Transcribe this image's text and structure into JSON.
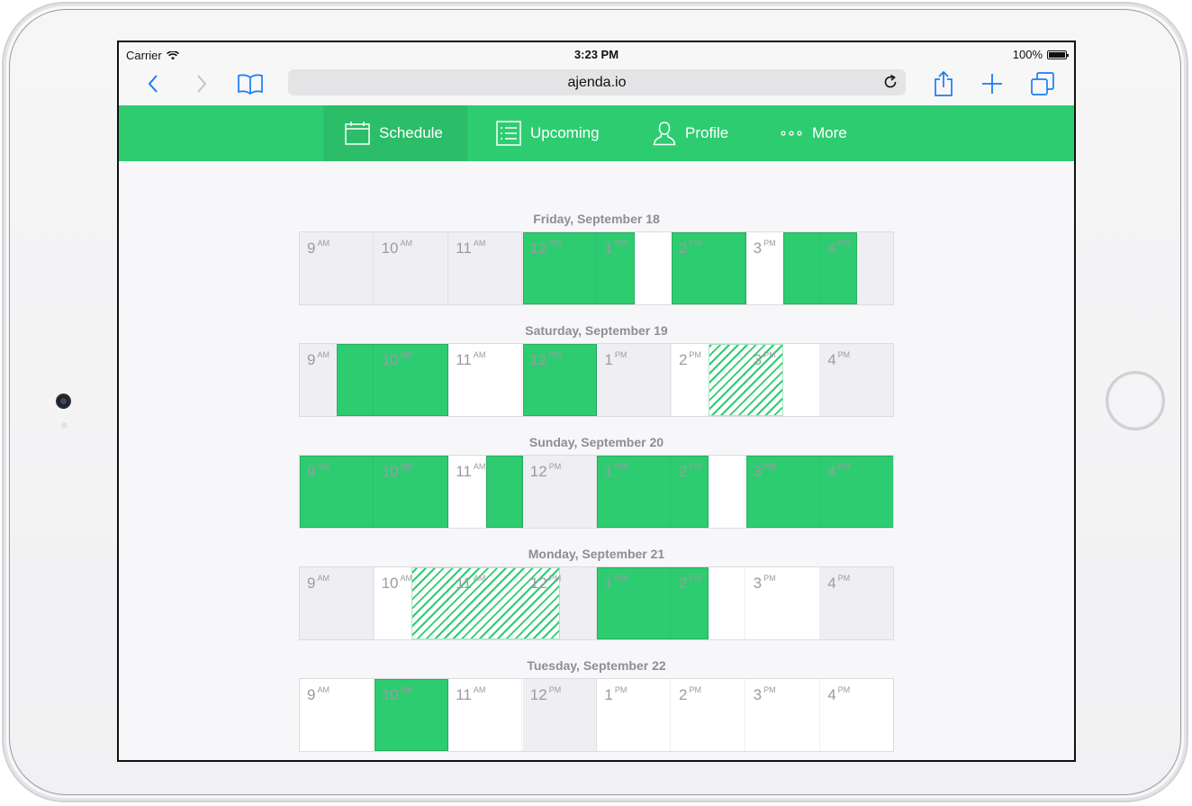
{
  "status_bar": {
    "carrier": "Carrier",
    "time": "3:23 PM",
    "battery": "100%"
  },
  "browser": {
    "url": "ajenda.io"
  },
  "nav": {
    "items": [
      {
        "label": "Schedule",
        "icon": "calendar-icon",
        "active": true
      },
      {
        "label": "Upcoming",
        "icon": "list-icon",
        "active": false
      },
      {
        "label": "Profile",
        "icon": "person-icon",
        "active": false
      },
      {
        "label": "More",
        "icon": "more-dots-icon",
        "active": false
      }
    ]
  },
  "colors": {
    "accent": "#2ecc71",
    "accent_dark": "#27ae60",
    "busy": "#2ecc71",
    "free": "#ffffff",
    "unavailable": "#efeff3"
  },
  "hours": [
    {
      "n": "9",
      "p": "AM"
    },
    {
      "n": "10",
      "p": "AM"
    },
    {
      "n": "11",
      "p": "AM"
    },
    {
      "n": "12",
      "p": "PM"
    },
    {
      "n": "1",
      "p": "PM"
    },
    {
      "n": "2",
      "p": "PM"
    },
    {
      "n": "3",
      "p": "PM"
    },
    {
      "n": "4",
      "p": "PM"
    }
  ],
  "days": [
    {
      "title": "Friday, September 18",
      "blocks": [
        {
          "start": 12,
          "end": 13.5,
          "status": "busy"
        },
        {
          "start": 13.5,
          "end": 14,
          "status": "free"
        },
        {
          "start": 14,
          "end": 15,
          "status": "busy"
        },
        {
          "start": 15,
          "end": 15.5,
          "status": "free"
        },
        {
          "start": 15.5,
          "end": 16.5,
          "status": "busy"
        }
      ]
    },
    {
      "title": "Saturday, September 19",
      "blocks": [
        {
          "start": 9.5,
          "end": 11,
          "status": "busy"
        },
        {
          "start": 11,
          "end": 12,
          "status": "free"
        },
        {
          "start": 12,
          "end": 13,
          "status": "busy"
        },
        {
          "start": 14,
          "end": 14.5,
          "status": "free"
        },
        {
          "start": 14.5,
          "end": 15.5,
          "status": "tentative"
        },
        {
          "start": 15.5,
          "end": 16,
          "status": "free"
        }
      ]
    },
    {
      "title": "Sunday, September 20",
      "blocks": [
        {
          "start": 9,
          "end": 11,
          "status": "busy"
        },
        {
          "start": 11,
          "end": 11.5,
          "status": "free"
        },
        {
          "start": 11.5,
          "end": 12,
          "status": "busy"
        },
        {
          "start": 13,
          "end": 14.5,
          "status": "busy"
        },
        {
          "start": 14.5,
          "end": 15,
          "status": "free"
        },
        {
          "start": 15,
          "end": 17,
          "status": "busy"
        }
      ]
    },
    {
      "title": "Monday, September 21",
      "blocks": [
        {
          "start": 10,
          "end": 10.5,
          "status": "free"
        },
        {
          "start": 10.5,
          "end": 12.5,
          "status": "tentative"
        },
        {
          "start": 13,
          "end": 14.5,
          "status": "busy"
        },
        {
          "start": 14.5,
          "end": 16,
          "status": "free"
        }
      ]
    },
    {
      "title": "Tuesday, September 22",
      "blocks": [
        {
          "start": 9,
          "end": 10,
          "status": "free"
        },
        {
          "start": 10,
          "end": 11,
          "status": "busy"
        },
        {
          "start": 11,
          "end": 12,
          "status": "free"
        },
        {
          "start": 13,
          "end": 17,
          "status": "free"
        }
      ]
    }
  ]
}
